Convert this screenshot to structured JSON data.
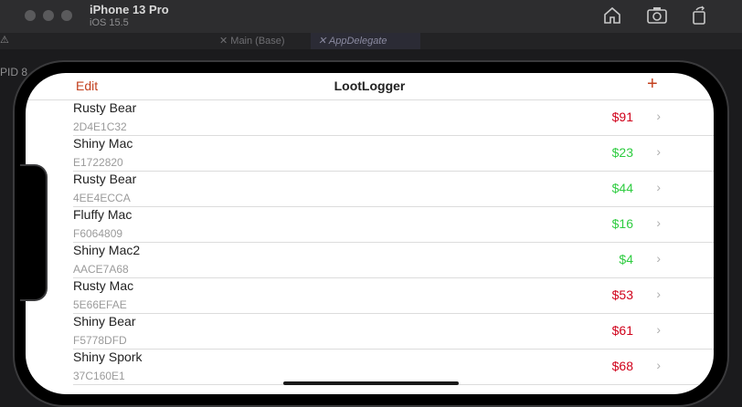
{
  "simulator": {
    "device_name": "iPhone 13 Pro",
    "os_version": "iOS 15.5",
    "icons": [
      "home-icon",
      "screenshot-icon",
      "rotate-icon"
    ]
  },
  "xcode": {
    "tabs": [
      "Main (Base)",
      "AppDelegate"
    ],
    "pid_label": "PID 8"
  },
  "app": {
    "nav": {
      "edit_label": "Edit",
      "title": "LootLogger",
      "add_label": "+"
    },
    "colors": {
      "accent": "#c3401e",
      "value_high": "#d0021b",
      "value_low": "#2ecc40"
    },
    "items": [
      {
        "name": "Rusty Bear",
        "serial": "2D4E1C32",
        "value": "$91",
        "tier": "high"
      },
      {
        "name": "Shiny Mac",
        "serial": "E1722820",
        "value": "$23",
        "tier": "low"
      },
      {
        "name": "Rusty Bear",
        "serial": "4EE4ECCA",
        "value": "$44",
        "tier": "low"
      },
      {
        "name": "Fluffy Mac",
        "serial": "F6064809",
        "value": "$16",
        "tier": "low"
      },
      {
        "name": "Shiny Mac2",
        "serial": "AACE7A68",
        "value": "$4",
        "tier": "low"
      },
      {
        "name": "Rusty Mac",
        "serial": "5E66EFAE",
        "value": "$53",
        "tier": "high"
      },
      {
        "name": "Shiny Bear",
        "serial": "F5778DFD",
        "value": "$61",
        "tier": "high"
      },
      {
        "name": "Shiny Spork",
        "serial": "37C160E1",
        "value": "$68",
        "tier": "high"
      }
    ]
  }
}
